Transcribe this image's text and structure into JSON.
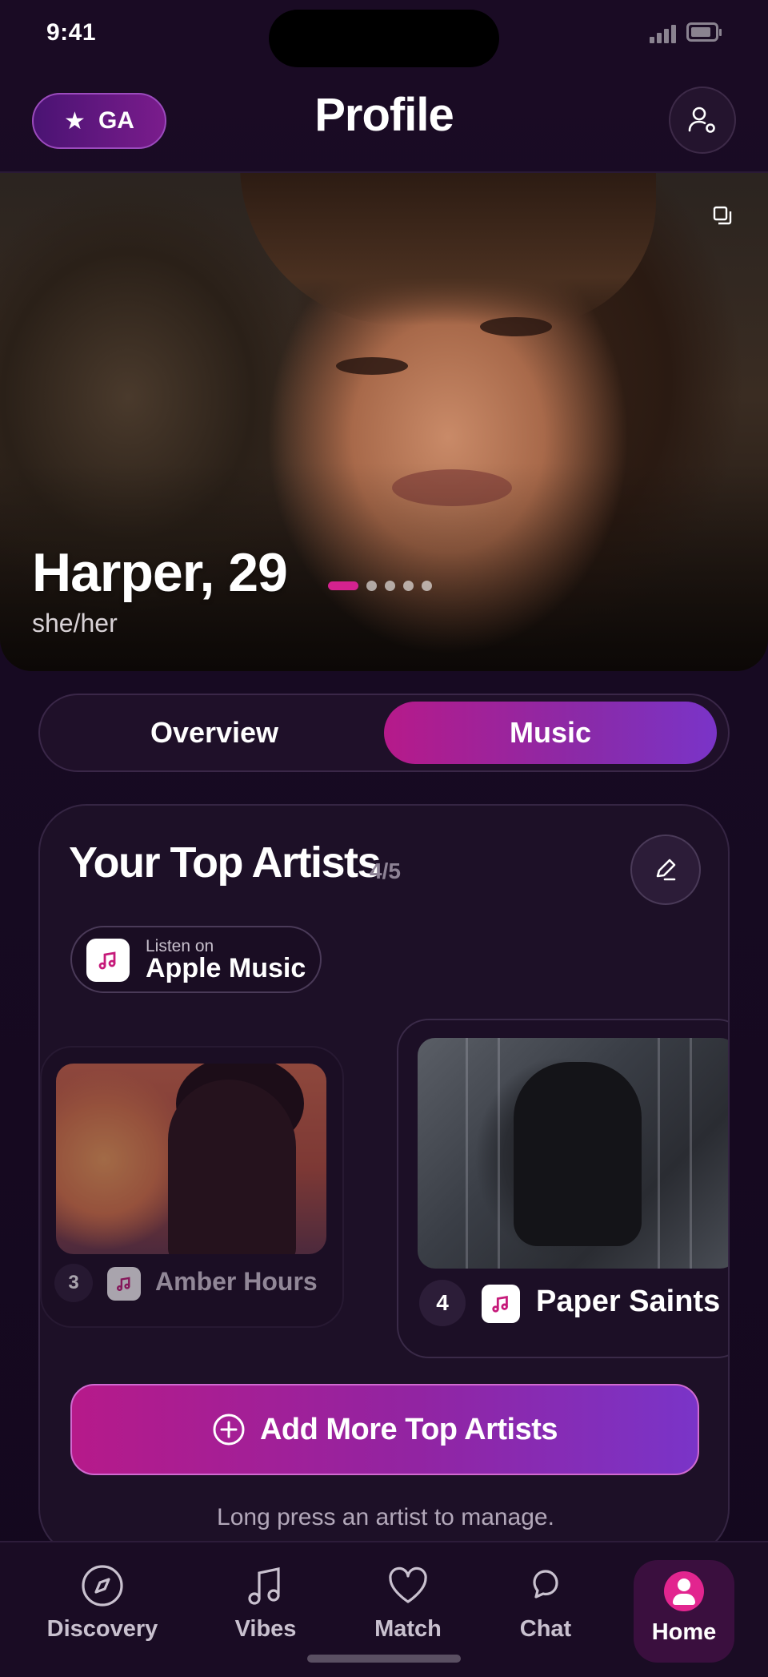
{
  "status_bar": {
    "time": "9:41"
  },
  "header": {
    "badge_label": "GA",
    "badge_icon": "star-icon",
    "title": "Profile",
    "action_icon": "user-settings-icon"
  },
  "profile": {
    "name_age": "Harper, 29",
    "pronouns": "she/her",
    "photo_count": 5,
    "active_photo": 1
  },
  "tabs": [
    {
      "label": "Overview",
      "active": false
    },
    {
      "label": "Music",
      "active": true
    }
  ],
  "top_artists": {
    "title": "Your Top Artists",
    "count": "4/5",
    "service": {
      "prefix": "Listen on",
      "name": "Apple Music"
    },
    "artists": [
      {
        "rank": "3",
        "name": "Amber Hours"
      },
      {
        "rank": "4",
        "name": "Paper Saints"
      }
    ],
    "add_button": "Add More Top Artists",
    "hint": "Long press an artist to manage."
  },
  "nav": [
    {
      "label": "Discovery",
      "icon": "compass-icon"
    },
    {
      "label": "Vibes",
      "icon": "music-note-icon"
    },
    {
      "label": "Match",
      "icon": "heart-icon"
    },
    {
      "label": "Chat",
      "icon": "chat-bubble-icon"
    },
    {
      "label": "Home",
      "icon": "profile-icon",
      "active": true
    }
  ],
  "colors": {
    "accent": "#d4228f",
    "gradient_start": "#b61a8a",
    "gradient_end": "#7a34c8",
    "background": "#170a22"
  }
}
